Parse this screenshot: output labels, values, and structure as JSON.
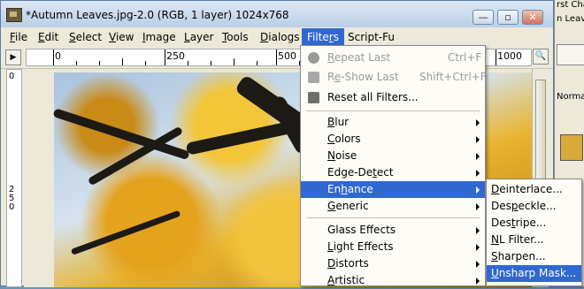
{
  "window": {
    "title": "*Autumn Leaves.jpg-2.0 (RGB, 1 layer) 1024x768",
    "controls": [
      "—",
      "▫",
      "✕"
    ]
  },
  "menubar": [
    {
      "pre": "",
      "ul": "F",
      "post": "ile"
    },
    {
      "pre": "",
      "ul": "E",
      "post": "dit"
    },
    {
      "pre": "",
      "ul": "S",
      "post": "elect"
    },
    {
      "pre": "",
      "ul": "V",
      "post": "iew"
    },
    {
      "pre": "",
      "ul": "I",
      "post": "mage"
    },
    {
      "pre": "",
      "ul": "L",
      "post": "ayer"
    },
    {
      "pre": "",
      "ul": "T",
      "post": "ools"
    },
    {
      "pre": "",
      "ul": "D",
      "post": "ialogs"
    },
    {
      "pre": "Filte",
      "ul": "r",
      "post": "s"
    },
    {
      "pre": "Script-Fu",
      "ul": "",
      "post": ""
    }
  ],
  "ruler": {
    "h_labels": [
      "0",
      "250",
      "500",
      "1000"
    ],
    "v_labels": [
      "0",
      "2",
      "5",
      "0"
    ]
  },
  "filters_menu": {
    "items": [
      {
        "pre": "",
        "ul": "R",
        "post": "epeat Last",
        "shortcut": "Ctrl+F",
        "disabled": true,
        "icon": "repeat-icon",
        "submenu": false
      },
      {
        "pre": "R",
        "ul": "e",
        "post": "-Show Last",
        "shortcut": "Shift+Ctrl+F",
        "disabled": true,
        "icon": "reshow-icon",
        "submenu": false
      },
      {
        "pre": "Reset all Filters...",
        "ul": "",
        "post": "",
        "shortcut": "",
        "disabled": false,
        "icon": "reset-icon",
        "submenu": false
      },
      {
        "pre": "",
        "ul": "B",
        "post": "lur",
        "shortcut": "",
        "disabled": false,
        "submenu": true
      },
      {
        "pre": "",
        "ul": "C",
        "post": "olors",
        "shortcut": "",
        "disabled": false,
        "submenu": true
      },
      {
        "pre": "",
        "ul": "N",
        "post": "oise",
        "shortcut": "",
        "disabled": false,
        "submenu": true
      },
      {
        "pre": "Edge-De",
        "ul": "t",
        "post": "ect",
        "shortcut": "",
        "disabled": false,
        "submenu": true
      },
      {
        "pre": "En",
        "ul": "h",
        "post": "ance",
        "shortcut": "",
        "disabled": false,
        "submenu": true,
        "highlighted": true
      },
      {
        "pre": "",
        "ul": "G",
        "post": "eneric",
        "shortcut": "",
        "disabled": false,
        "submenu": true
      },
      {
        "pre": "Glass Effects",
        "ul": "",
        "post": "",
        "shortcut": "",
        "disabled": false,
        "submenu": true
      },
      {
        "pre": "",
        "ul": "L",
        "post": "ight Effects",
        "shortcut": "",
        "disabled": false,
        "submenu": true
      },
      {
        "pre": "",
        "ul": "D",
        "post": "istorts",
        "shortcut": "",
        "disabled": false,
        "submenu": true
      },
      {
        "pre": "",
        "ul": "A",
        "post": "rtistic",
        "shortcut": "",
        "disabled": false,
        "submenu": true
      }
    ]
  },
  "enhance_menu": {
    "items": [
      {
        "pre": "",
        "ul": "D",
        "post": "einterlace..."
      },
      {
        "pre": "Des",
        "ul": "p",
        "post": "eckle..."
      },
      {
        "pre": "Des",
        "ul": "t",
        "post": "ripe..."
      },
      {
        "pre": "",
        "ul": "N",
        "post": "L Filter..."
      },
      {
        "pre": "",
        "ul": "S",
        "post": "harpen..."
      },
      {
        "pre": "",
        "ul": "U",
        "post": "nsharp Mask...",
        "highlighted": true
      }
    ]
  },
  "right_panel": {
    "texts": [
      "rst Chann",
      "n Leav",
      "Norma"
    ]
  },
  "colors": {
    "highlight": "#3068d0",
    "menu_bg": "#fdfcf7",
    "disabled_text": "#9a9a9a"
  }
}
